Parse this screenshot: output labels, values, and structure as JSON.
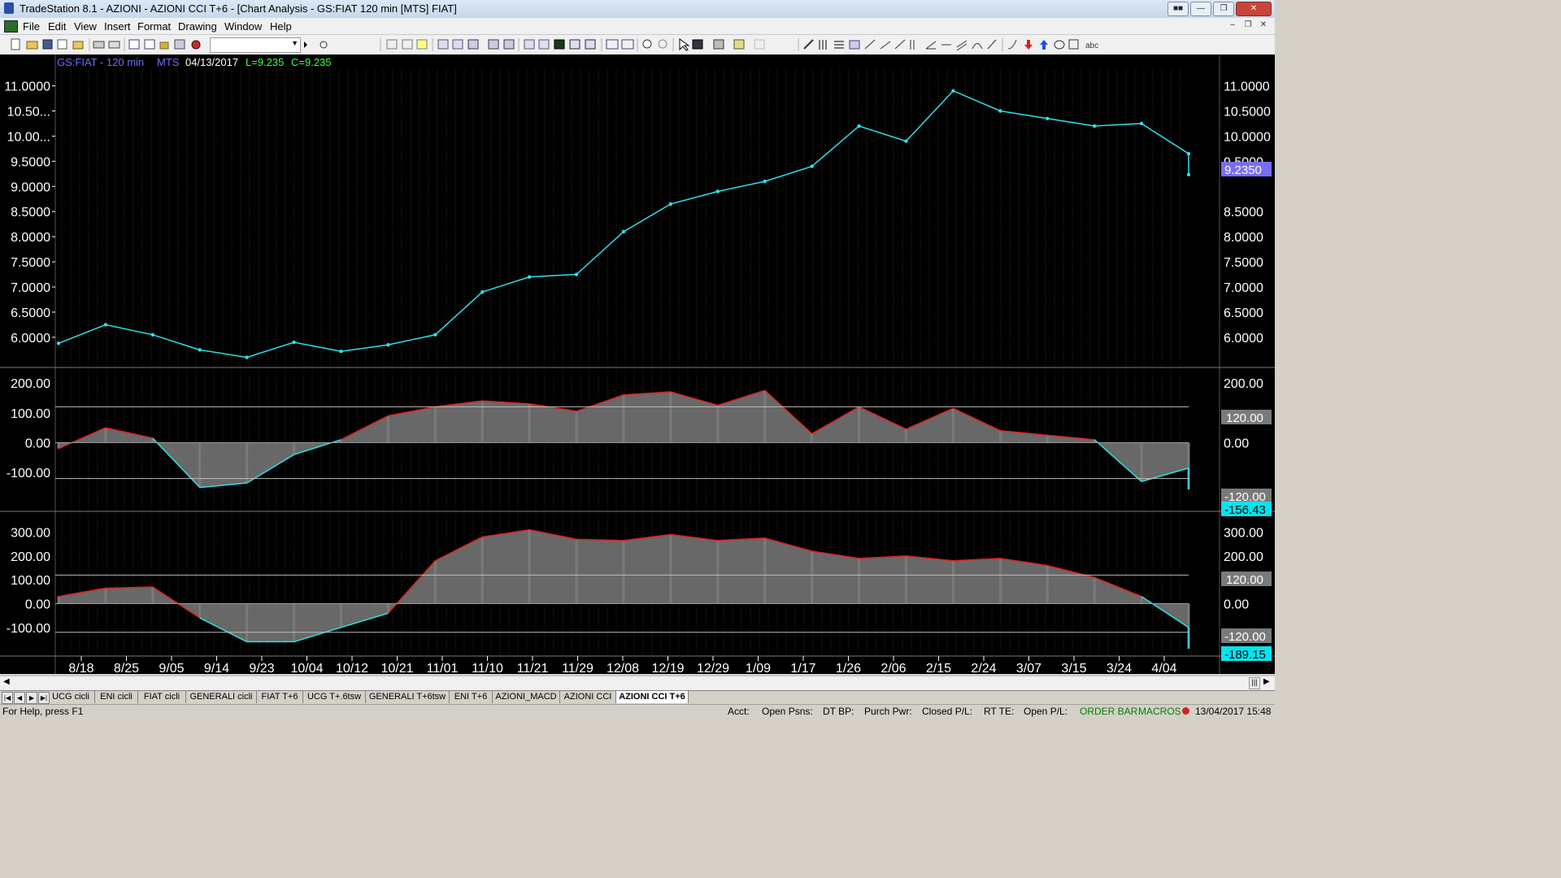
{
  "window": {
    "title": "TradeStation 8.1 - AZIONI - AZIONI CCI T+6 - [Chart Analysis - GS:FIAT  120 min  [MTS] FIAT]"
  },
  "menu": [
    "File",
    "Edit",
    "View",
    "Insert",
    "Format",
    "Drawing",
    "Window",
    "Help"
  ],
  "chart_header": {
    "symbol": "GS:FIAT - 120 min",
    "source": "MTS",
    "date": "04/13/2017",
    "last": "L=9.235",
    "close": "C=9.235"
  },
  "colors": {
    "price": "#2fe0ea",
    "indicator_fill": "#7a7a7a",
    "indicator_pos_line": "#e02020",
    "indicator_neg_line": "#2fe0ea",
    "header_symbol": "#6f6fff",
    "header_values": "#40ff40",
    "last_price_box": "#7a6df5",
    "last_indicator_box": "#00e6f0"
  },
  "price_axis": {
    "labels": [
      "11.0000",
      "10.50...",
      "10.00...",
      "9.5000",
      "9.0000",
      "8.5000",
      "8.0000",
      "7.5000",
      "7.0000",
      "6.5000",
      "6.0000"
    ],
    "right_labels": [
      "11.0000",
      "10.5000",
      "10.0000",
      "9.5000",
      "9.0000",
      "8.5000",
      "8.0000",
      "7.5000",
      "7.0000",
      "6.5000",
      "6.0000"
    ],
    "last_value_box": "9.2350"
  },
  "cci1_axis": {
    "labels": [
      "200.00",
      "100.00",
      "0.00",
      "-100.00"
    ],
    "right_labels": [
      "200.00",
      "0.00"
    ],
    "upper_box": "120.00",
    "lower_box": "-120.00",
    "last_value_box": "-156.43"
  },
  "cci2_axis": {
    "labels": [
      "300.00",
      "200.00",
      "100.00",
      "0.00",
      "-100.00"
    ],
    "right_labels": [
      "300.00",
      "200.00",
      "0.00"
    ],
    "upper_box": "120.00",
    "lower_box": "-120.00",
    "last_value_box": "-189.15"
  },
  "date_axis": [
    "8/18",
    "8/25",
    "9/05",
    "9/14",
    "9/23",
    "10/04",
    "10/12",
    "10/21",
    "11/01",
    "11/10",
    "11/21",
    "11/29",
    "12/08",
    "12/19",
    "12/29",
    "1/09",
    "1/17",
    "1/26",
    "2/06",
    "2/15",
    "2/24",
    "3/07",
    "3/15",
    "3/24",
    "4/04"
  ],
  "chart_data": [
    {
      "type": "line",
      "name_printed": "GS:FIAT - 120 min",
      "x": [
        "8/18",
        "8/25",
        "9/05",
        "9/14",
        "9/23",
        "10/04",
        "10/12",
        "10/21",
        "11/01",
        "11/10",
        "11/21",
        "11/29",
        "12/08",
        "12/19",
        "12/29",
        "1/09",
        "1/17",
        "1/26",
        "2/06",
        "2/15",
        "2/24",
        "3/07",
        "3/15",
        "3/24",
        "4/04"
      ],
      "y": [
        5.88,
        6.25,
        6.05,
        5.75,
        5.6,
        5.9,
        5.72,
        5.85,
        6.05,
        6.9,
        7.2,
        7.25,
        8.1,
        8.65,
        8.9,
        9.1,
        9.4,
        10.2,
        9.9,
        10.9,
        10.5,
        10.35,
        10.2,
        10.25,
        9.65
      ],
      "last": 9.235,
      "ylim": [
        5.4,
        11.3
      ],
      "grid": true
    },
    {
      "type": "area",
      "x": [
        "8/18",
        "8/25",
        "9/05",
        "9/14",
        "9/23",
        "10/04",
        "10/12",
        "10/21",
        "11/01",
        "11/10",
        "11/21",
        "11/29",
        "12/08",
        "12/19",
        "12/29",
        "1/09",
        "1/17",
        "1/26",
        "2/06",
        "2/15",
        "2/24",
        "3/07",
        "3/15",
        "3/24",
        "4/04"
      ],
      "y": [
        -20,
        50,
        15,
        -150,
        -135,
        -40,
        10,
        90,
        120,
        140,
        130,
        105,
        160,
        170,
        125,
        175,
        30,
        120,
        45,
        115,
        40,
        25,
        10,
        -130,
        -85
      ],
      "last": -156.43,
      "levels": [
        120,
        -120
      ],
      "ylim": [
        -230,
        230
      ]
    },
    {
      "type": "area",
      "x": [
        "8/18",
        "8/25",
        "9/05",
        "9/14",
        "9/23",
        "10/04",
        "10/12",
        "10/21",
        "11/01",
        "11/10",
        "11/21",
        "11/29",
        "12/08",
        "12/19",
        "12/29",
        "1/09",
        "1/17",
        "1/26",
        "2/06",
        "2/15",
        "2/24",
        "3/07",
        "3/15",
        "3/24",
        "4/04"
      ],
      "y": [
        30,
        65,
        70,
        -60,
        -160,
        -160,
        -100,
        -40,
        180,
        280,
        310,
        270,
        265,
        290,
        265,
        275,
        220,
        190,
        200,
        180,
        190,
        160,
        110,
        30,
        -100
      ],
      "last": -189.15,
      "levels": [
        120,
        -120
      ],
      "ylim": [
        -220,
        360
      ]
    }
  ],
  "tabs": [
    "UCG cicli",
    "ENI cicli",
    "FIAT cicli",
    "GENERALI cicli",
    "FIAT T+6",
    "UCG T+.6tsw",
    "GENERALI T+6tsw",
    "ENI T+6",
    "AZIONI_MACD",
    "AZIONI CCI",
    "AZIONI CCI T+6"
  ],
  "active_tab": "AZIONI CCI T+6",
  "status": {
    "help": "For Help, press F1",
    "acct": "Acct:",
    "open_psns": "Open Psns:",
    "dt_bp": "DT BP:",
    "purch_pwr": "Purch Pwr:",
    "closed_pl": "Closed P/L:",
    "rt_te": "RT TE:",
    "open_pl": "Open P/L:",
    "order_bar": "ORDER BAR",
    "macros": "MACROS",
    "datetime": "13/04/2017 15:48"
  }
}
